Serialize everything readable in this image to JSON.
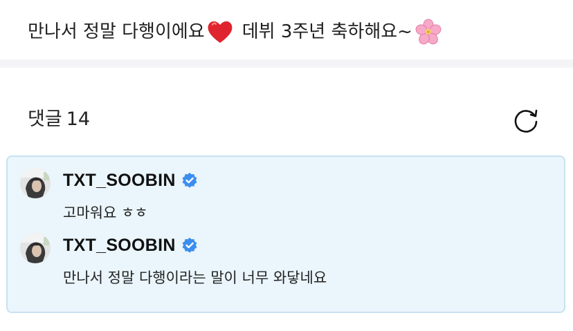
{
  "post": {
    "text_part1": "만나서 정말 다행이에요",
    "heart_emoji": "heart-emoji",
    "text_part2": "데뷔 3주년 축하해요~",
    "flower_emoji": "cherry-blossom-emoji"
  },
  "comments": {
    "label": "댓글",
    "count": "14",
    "refresh_icon": "refresh-icon"
  },
  "replies": [
    {
      "author": "TXT_SOOBIN",
      "verified": true,
      "text": "고마워요 ㅎㅎ"
    },
    {
      "author": "TXT_SOOBIN",
      "verified": true,
      "text": "만나서 정말 다행이라는 말이 너무 와닿네요"
    }
  ],
  "colors": {
    "reply_background": "#eaf5fc",
    "reply_border": "#c6e2f2",
    "verified_badge": "#3b8ef0",
    "heart": "#e0242f"
  }
}
